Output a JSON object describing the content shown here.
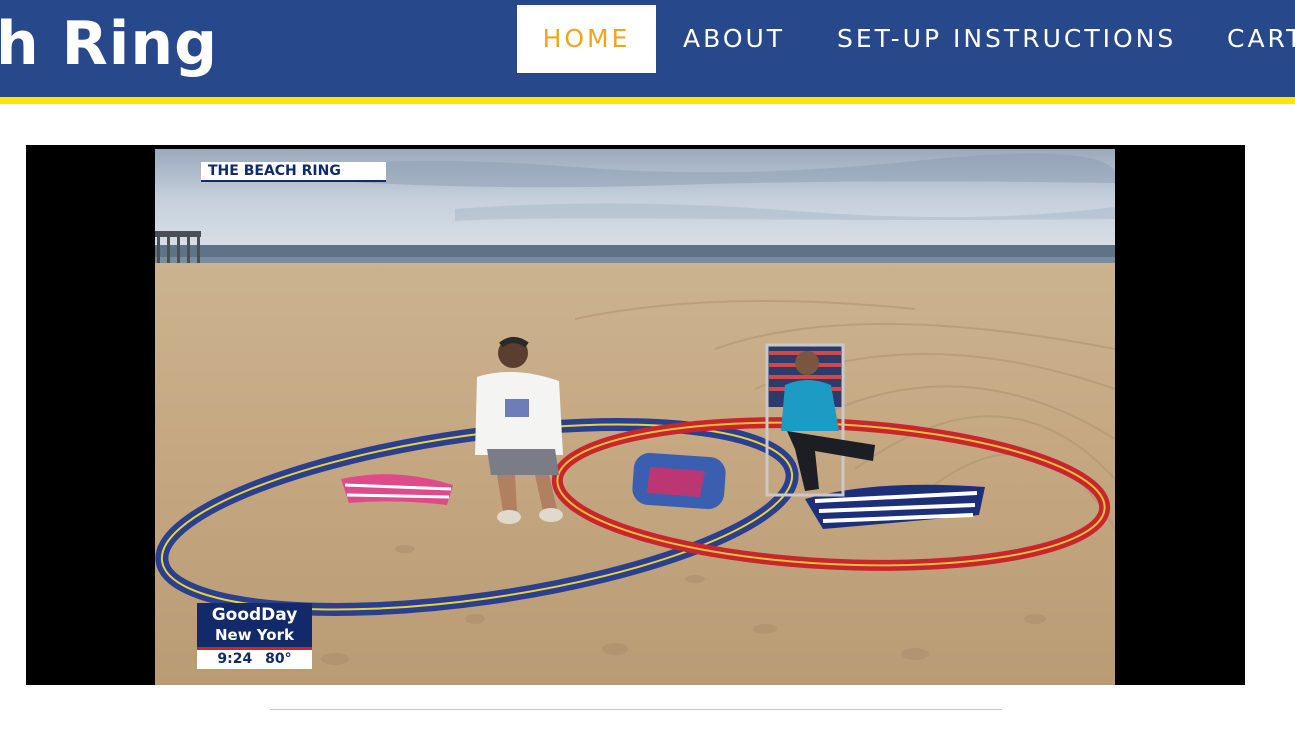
{
  "header": {
    "logo_text": "h Ring",
    "nav": [
      {
        "label": "HOME",
        "active": true
      },
      {
        "label": "ABOUT",
        "active": false
      },
      {
        "label": "SET-UP INSTRUCTIONS",
        "active": false
      },
      {
        "label": "CART",
        "active": false
      }
    ]
  },
  "video": {
    "bug_text": "THE BEACH RING",
    "lower_third": {
      "line1": "GoodDay",
      "line2": "New York",
      "time": "9:24",
      "temp": "80°"
    }
  },
  "colors": {
    "header_bg": "#27498c",
    "accent_yellow": "#ffe600",
    "active_nav_text": "#f0a51f",
    "ring_blue": "#2a3f8f",
    "ring_red": "#c8262c"
  }
}
